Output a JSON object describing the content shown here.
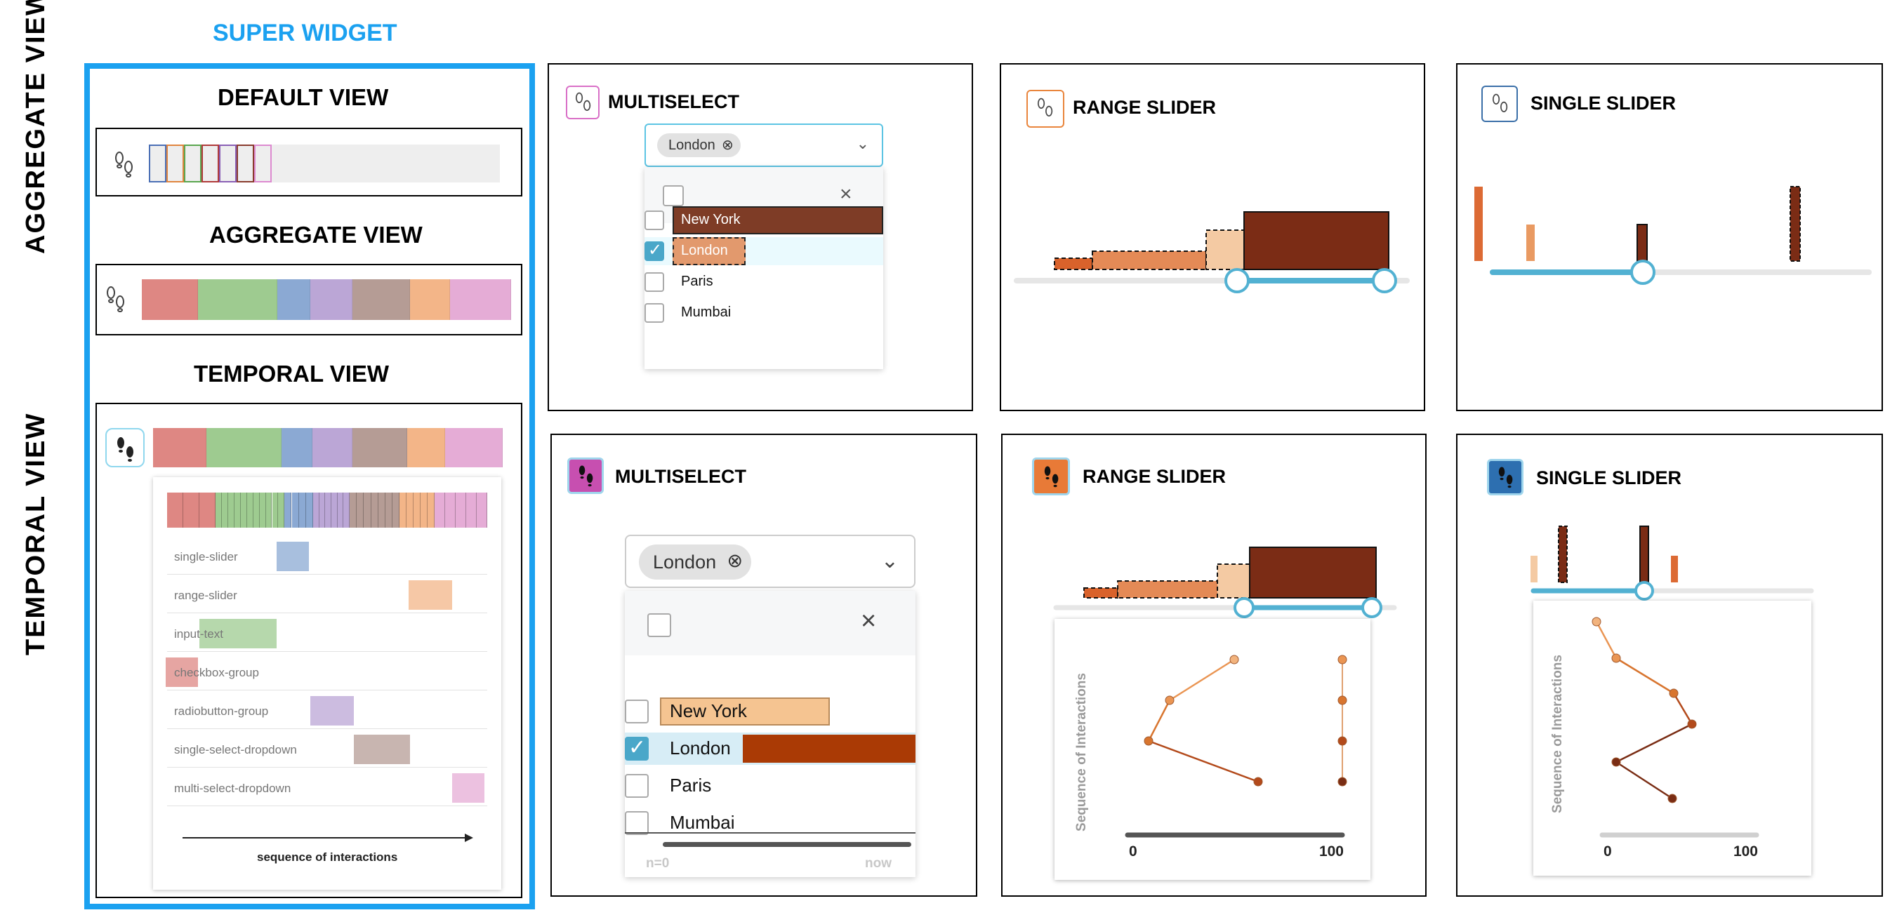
{
  "super_widget": {
    "header": "SUPER WIDGET",
    "default_view": "DEFAULT VIEW",
    "aggregate_view": "AGGREGATE VIEW",
    "temporal_view": "TEMPORAL VIEW",
    "timeline_rows": [
      "single-slider",
      "range-slider",
      "input-text",
      "checkbox-group",
      "radiobutton-group",
      "single-select-dropdown",
      "multi-select-dropdown"
    ],
    "axis_caption": "sequence of interactions",
    "colors": [
      "#de8783",
      "#9ecb90",
      "#8ba9d3",
      "#bba6d6",
      "#b59c95",
      "#f3b588",
      "#e5acd6"
    ],
    "outline_colors": [
      "#4b6fb5",
      "#e0853f",
      "#5aa64f",
      "#b03a3a",
      "#8a5fb5",
      "#8a3c2e",
      "#dd8ad0"
    ]
  },
  "row_labels": {
    "top": "AGGREGATE VIEW",
    "bottom": "TEMPORAL VIEW"
  },
  "panels": {
    "multiselect": {
      "title": "MULTISELECT",
      "chip": "London",
      "options": [
        "New York",
        "London",
        "Paris",
        "Mumbai"
      ]
    },
    "range_slider": {
      "title": "RANGE SLIDER"
    },
    "single_slider": {
      "title": "SINGLE SLIDER"
    }
  },
  "temporal_multiselect": {
    "footer_left": "n=0",
    "footer_right": "now"
  },
  "chart_data": [
    {
      "type": "line",
      "ylabel": "Sequence of Interactions",
      "x_ticks": [
        "0",
        "100"
      ],
      "xlim": [
        0,
        100
      ]
    },
    {
      "type": "line",
      "ylabel": "Sequence of Interactions",
      "x_ticks": [
        "0",
        "100"
      ],
      "xlim": [
        0,
        100
      ]
    }
  ]
}
